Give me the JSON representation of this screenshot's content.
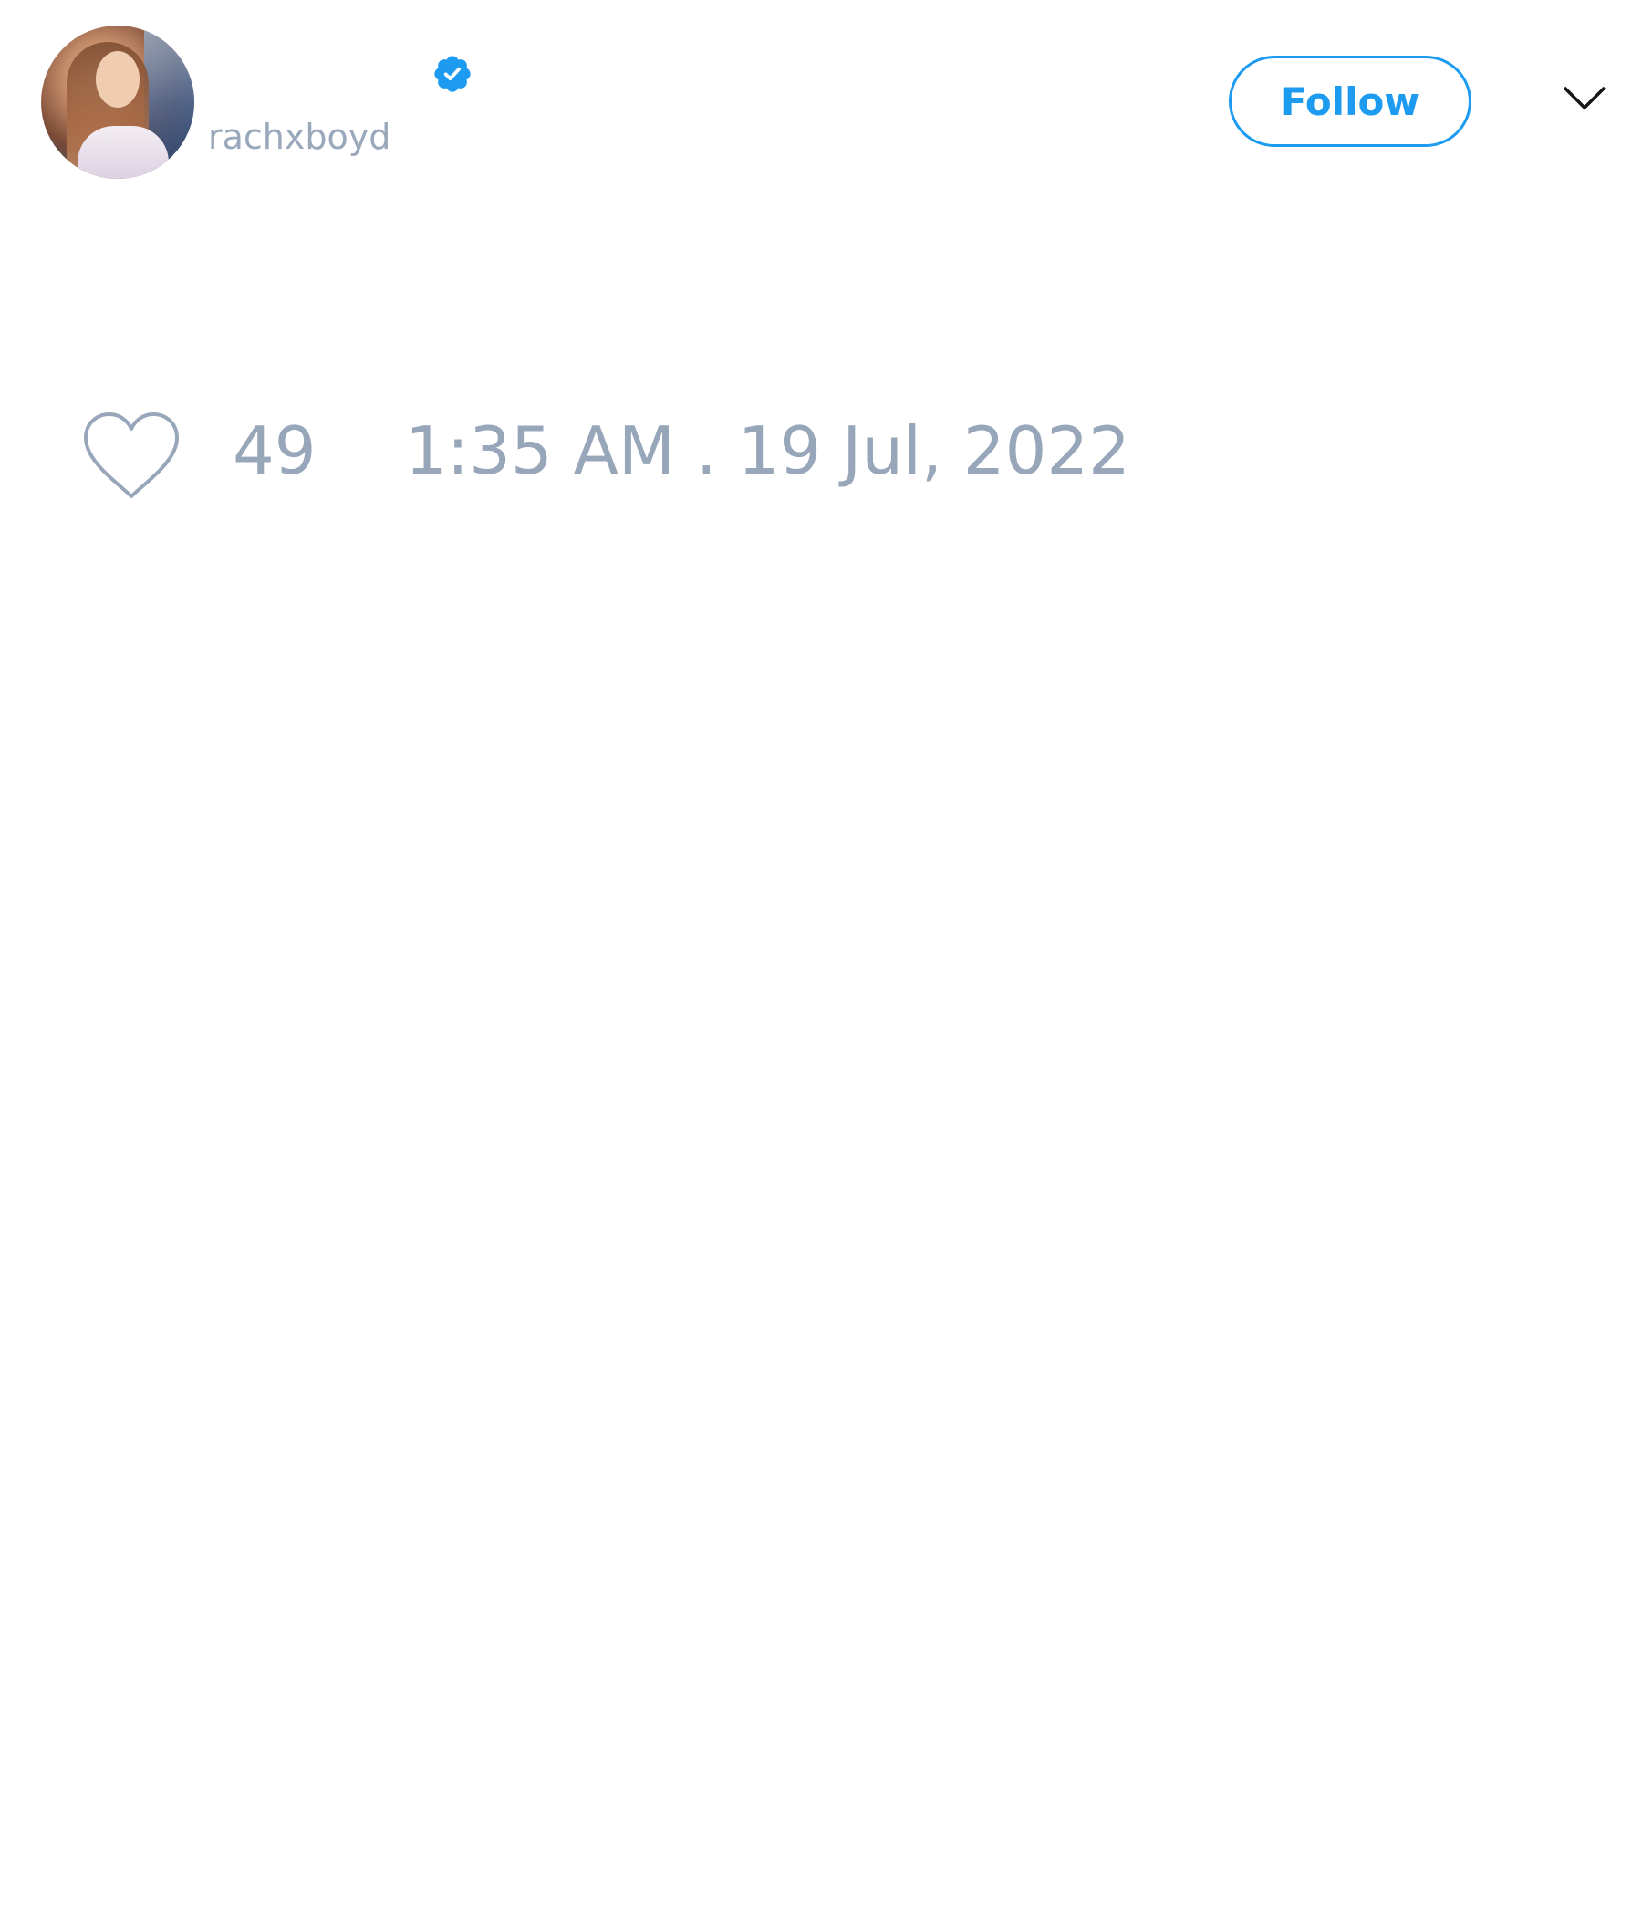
{
  "author": {
    "display_name": "",
    "handle": "rachxboyd",
    "verified": true
  },
  "header": {
    "follow_label": "Follow",
    "menu_icon": "chevron-down-icon",
    "verified_icon": "verified-badge-icon"
  },
  "stats": {
    "like_icon": "heart-icon",
    "likes": "49",
    "timestamp": "1:35 AM . 19 Jul, 2022"
  },
  "colors": {
    "accent": "#1d9bf0",
    "muted_text": "#98a6ba",
    "background": "#ffffff",
    "icon_dark": "#14171a"
  }
}
